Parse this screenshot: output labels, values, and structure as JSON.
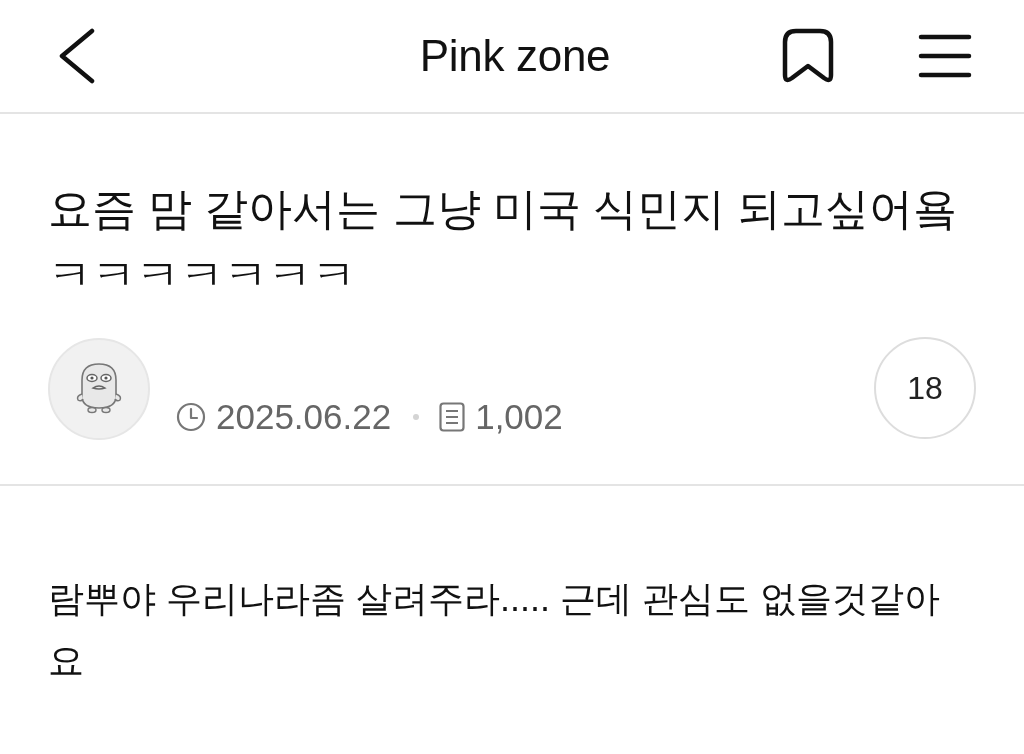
{
  "header": {
    "title": "Pink zone"
  },
  "post": {
    "title": "요즘 맘 같아서는 그냥 미국 식민지 되고싶어욬ㅋㅋㅋㅋㅋㅋㅋ",
    "date": "2025.06.22",
    "views": "1,002",
    "comment_count": "18",
    "body": "람뿌야 우리나라좀 살려주라..... 근데 관심도 없을것같아요"
  }
}
